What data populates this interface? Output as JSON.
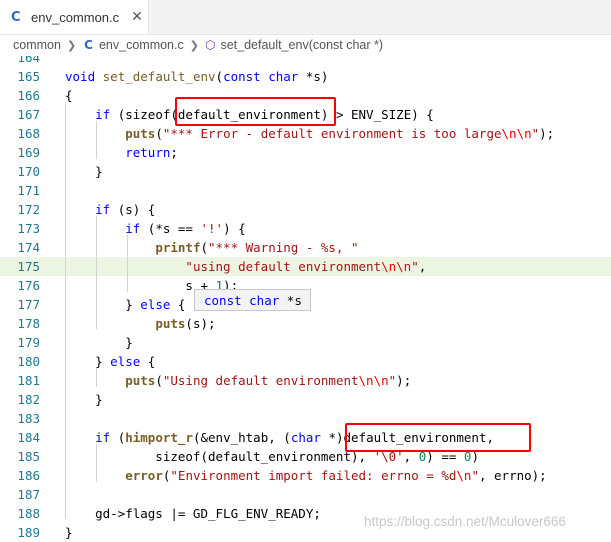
{
  "tab": {
    "lang_icon": "C",
    "label": "env_common.c",
    "close_glyph": "✕"
  },
  "breadcrumb": {
    "parts": [
      "common",
      "env_common.c",
      "set_default_env(const char *)"
    ],
    "lang_icon": "C"
  },
  "tooltip": {
    "type": "const char",
    "rest": " *s"
  },
  "watermark": "https://blog.csdn.net/Mculover666",
  "lines": [
    {
      "n": "164",
      "tokens": []
    },
    {
      "n": "165",
      "tokens": [
        [
          "kw",
          "void"
        ],
        [
          "p",
          " "
        ],
        [
          "fnn",
          "set_default_env"
        ],
        [
          "p",
          "("
        ],
        [
          "kw",
          "const char"
        ],
        [
          "p",
          " *s)"
        ]
      ]
    },
    {
      "n": "166",
      "tokens": [
        [
          "p",
          "{"
        ]
      ]
    },
    {
      "n": "167",
      "tokens": [
        [
          "p",
          "    "
        ],
        [
          "kw",
          "if"
        ],
        [
          "p",
          " (sizeof("
        ],
        [
          "p",
          "default_environment"
        ],
        [
          "p",
          ") > ENV_SIZE) {"
        ]
      ]
    },
    {
      "n": "168",
      "tokens": [
        [
          "p",
          "        "
        ],
        [
          "fn",
          "puts"
        ],
        [
          "p",
          "("
        ],
        [
          "str",
          "\"*** Error - default environment is too large"
        ],
        [
          "esc",
          "\\n\\n"
        ],
        [
          "str",
          "\""
        ],
        [
          "p",
          ");"
        ]
      ]
    },
    {
      "n": "169",
      "tokens": [
        [
          "p",
          "        "
        ],
        [
          "kw",
          "return"
        ],
        [
          "p",
          ";"
        ]
      ]
    },
    {
      "n": "170",
      "tokens": [
        [
          "p",
          "    }"
        ]
      ]
    },
    {
      "n": "171",
      "tokens": []
    },
    {
      "n": "172",
      "tokens": [
        [
          "p",
          "    "
        ],
        [
          "kw",
          "if"
        ],
        [
          "p",
          " (s) {"
        ]
      ]
    },
    {
      "n": "173",
      "tokens": [
        [
          "p",
          "        "
        ],
        [
          "kw",
          "if"
        ],
        [
          "p",
          " (*s == "
        ],
        [
          "str",
          "'!'"
        ],
        [
          "p",
          ") {"
        ]
      ]
    },
    {
      "n": "174",
      "tokens": [
        [
          "p",
          "            "
        ],
        [
          "fn",
          "printf"
        ],
        [
          "p",
          "("
        ],
        [
          "str",
          "\"*** Warning - %s, \""
        ]
      ]
    },
    {
      "n": "175",
      "tokens": [
        [
          "p",
          "                "
        ],
        [
          "str",
          "\"using default environment"
        ],
        [
          "esc",
          "\\n\\n"
        ],
        [
          "str",
          "\""
        ],
        [
          "p",
          ","
        ]
      ]
    },
    {
      "n": "176",
      "tokens": [
        [
          "p",
          "                s + "
        ],
        [
          "num",
          "1"
        ],
        [
          "p",
          ");"
        ]
      ]
    },
    {
      "n": "177",
      "tokens": [
        [
          "p",
          "        } "
        ],
        [
          "kw",
          "else"
        ],
        [
          "p",
          " {"
        ]
      ]
    },
    {
      "n": "178",
      "tokens": [
        [
          "p",
          "            "
        ],
        [
          "fn",
          "puts"
        ],
        [
          "p",
          "(s);"
        ]
      ]
    },
    {
      "n": "179",
      "tokens": [
        [
          "p",
          "        }"
        ]
      ]
    },
    {
      "n": "180",
      "tokens": [
        [
          "p",
          "    } "
        ],
        [
          "kw",
          "else"
        ],
        [
          "p",
          " {"
        ]
      ]
    },
    {
      "n": "181",
      "tokens": [
        [
          "p",
          "        "
        ],
        [
          "fn",
          "puts"
        ],
        [
          "p",
          "("
        ],
        [
          "str",
          "\"Using default environment"
        ],
        [
          "esc",
          "\\n\\n"
        ],
        [
          "str",
          "\""
        ],
        [
          "p",
          ");"
        ]
      ]
    },
    {
      "n": "182",
      "tokens": [
        [
          "p",
          "    }"
        ]
      ]
    },
    {
      "n": "183",
      "tokens": []
    },
    {
      "n": "184",
      "tokens": [
        [
          "p",
          "    "
        ],
        [
          "kw",
          "if"
        ],
        [
          "p",
          " ("
        ],
        [
          "fn",
          "himport_r"
        ],
        [
          "p",
          "(&env_htab, ("
        ],
        [
          "kw",
          "char"
        ],
        [
          "p",
          " *)default_environment,"
        ]
      ]
    },
    {
      "n": "185",
      "tokens": [
        [
          "p",
          "            sizeof(default_environment), "
        ],
        [
          "str",
          "'\\0'"
        ],
        [
          "p",
          ", "
        ],
        [
          "num",
          "0"
        ],
        [
          "p",
          ") == "
        ],
        [
          "num",
          "0"
        ],
        [
          "p",
          ")"
        ]
      ]
    },
    {
      "n": "186",
      "tokens": [
        [
          "p",
          "        "
        ],
        [
          "fn",
          "error"
        ],
        [
          "p",
          "("
        ],
        [
          "str",
          "\"Environment import failed: errno = %d"
        ],
        [
          "esc",
          "\\n"
        ],
        [
          "str",
          "\""
        ],
        [
          "p",
          ", errno);"
        ]
      ]
    },
    {
      "n": "187",
      "tokens": []
    },
    {
      "n": "188",
      "tokens": [
        [
          "p",
          "    gd->flags |= GD_FLG_ENV_READY;"
        ]
      ]
    },
    {
      "n": "189",
      "tokens": [
        [
          "p",
          "}"
        ]
      ]
    }
  ],
  "colors": {
    "keyword": "#0000ff",
    "function": "#795e26",
    "string": "#a31515",
    "escape": "#ee0000",
    "number": "#098658",
    "line_number": "#237893",
    "highlight_line": "#ebf5e1",
    "red_box": "#ff0000"
  }
}
